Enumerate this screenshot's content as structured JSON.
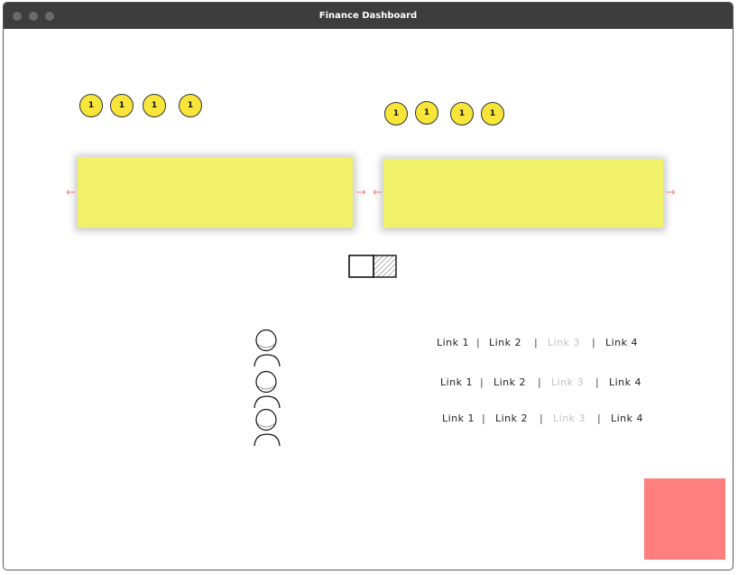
{
  "window": {
    "title": "Finance Dashboard"
  },
  "badges_left": [
    "1",
    "1",
    "1",
    "1"
  ],
  "badges_right": [
    "1",
    "1",
    "1",
    "1"
  ],
  "links": [
    {
      "items": [
        "Link 1",
        "Link 2",
        "Link 3",
        "Link 4"
      ],
      "disabled_index": 2
    },
    {
      "items": [
        "Link 1",
        "Link 2",
        "Link 3",
        "Link 4"
      ],
      "disabled_index": 2
    },
    {
      "items": [
        "Link 1",
        "Link 2",
        "Link 3",
        "Link 4"
      ],
      "disabled_index": 2
    }
  ],
  "colors": {
    "badge": "#f7e53a",
    "sticky_note": "#f2f26a",
    "arrow": "#f48b8b",
    "placeholder_box": "#ff7f7f",
    "titlebar": "#3d3d3d"
  },
  "icons": {
    "nav_arrows": "arrow-left / arrow-right",
    "avatars": "person-icon"
  }
}
